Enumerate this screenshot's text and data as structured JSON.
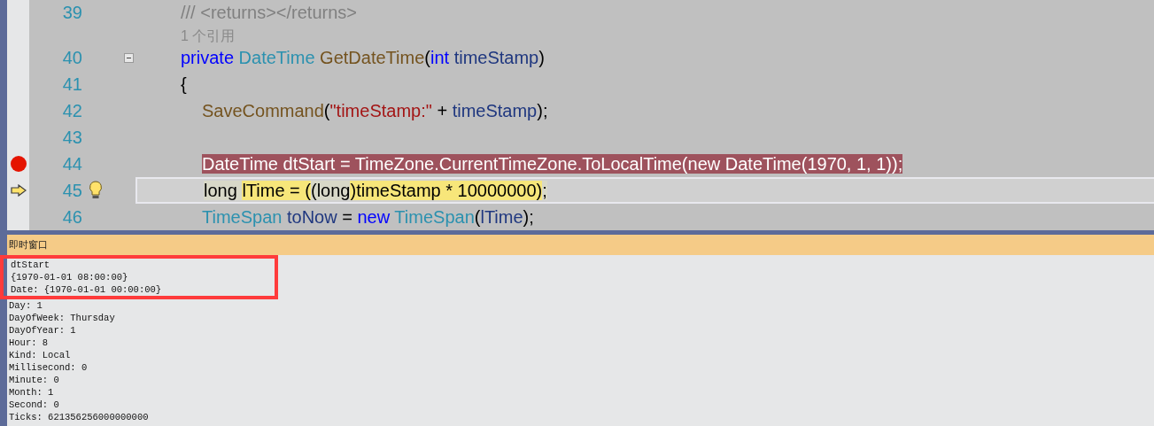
{
  "editor": {
    "lines": [
      {
        "kind": "code",
        "number": "39",
        "statement": false,
        "breakpoint": false,
        "current": false,
        "lightbulb": false,
        "tokens": [
          {
            "text": "/// <returns></returns>",
            "color": "#808080",
            "hl": false
          }
        ]
      },
      {
        "kind": "codelens",
        "text": "1 个引用"
      },
      {
        "kind": "code",
        "number": "40",
        "statement": false,
        "breakpoint": false,
        "current": false,
        "lightbulb": false,
        "expanded": true,
        "tokens": [
          {
            "text": "private ",
            "color": "#0000ff",
            "hl": false
          },
          {
            "text": "DateTime ",
            "color": "#2b91af",
            "hl": false
          },
          {
            "text": "GetDateTime",
            "color": "#74531f",
            "hl": false
          },
          {
            "text": "(",
            "color": "#000000",
            "hl": false
          },
          {
            "text": "int ",
            "color": "#0000ff",
            "hl": false
          },
          {
            "text": "timeStamp",
            "color": "#1f377f",
            "hl": false
          },
          {
            "text": ")",
            "color": "#000000",
            "hl": false
          }
        ]
      },
      {
        "kind": "code",
        "number": "41",
        "statement": false,
        "breakpoint": false,
        "current": false,
        "lightbulb": false,
        "tokens": [
          {
            "text": "{",
            "color": "#000000",
            "hl": false
          }
        ]
      },
      {
        "kind": "code",
        "number": "42",
        "statement": true,
        "breakpoint": false,
        "current": false,
        "lightbulb": false,
        "tokens": [
          {
            "text": "SaveCommand",
            "color": "#74531f",
            "hl": false
          },
          {
            "text": "(",
            "color": "#000000",
            "hl": false
          },
          {
            "text": "\"timeStamp:\"",
            "color": "#a31515",
            "hl": false
          },
          {
            "text": " + ",
            "color": "#000000",
            "hl": false
          },
          {
            "text": "timeStamp",
            "color": "#1f377f",
            "hl": false
          },
          {
            "text": ");",
            "color": "#000000",
            "hl": false
          }
        ]
      },
      {
        "kind": "code",
        "number": "43",
        "breakpoint": false,
        "current": false,
        "lightbulb": false
      },
      {
        "kind": "code",
        "number": "44",
        "statement": true,
        "breakpoint": true,
        "current": false,
        "lightbulb": false,
        "tokens": [
          {
            "text": "DateTime dtStart = TimeZone.CurrentTimeZone.ToLocalTime(new DateTime(1970, 1, 1));",
            "hl": false
          }
        ]
      },
      {
        "kind": "code",
        "number": "45",
        "statement": true,
        "breakpoint": false,
        "current": true,
        "lightbulb": true,
        "tokens": [
          {
            "text": "long ",
            "hl": false
          },
          {
            "text": "lTime = (",
            "hl": true
          },
          {
            "text": "(long",
            "hl": false
          },
          {
            "text": ")timeStamp * 10000000)",
            "hl": true
          },
          {
            "text": ";",
            "hl": false
          }
        ]
      },
      {
        "kind": "code",
        "number": "46",
        "statement": true,
        "breakpoint": false,
        "current": false,
        "lightbulb": false,
        "tokens": [
          {
            "text": "TimeSpan ",
            "color": "#2b91af",
            "hl": false
          },
          {
            "text": "toNow",
            "color": "#1f377f",
            "hl": false
          },
          {
            "text": " = ",
            "color": "#000000",
            "hl": false
          },
          {
            "text": "new ",
            "color": "#0000ff",
            "hl": false
          },
          {
            "text": "TimeSpan",
            "color": "#2b91af",
            "hl": false
          },
          {
            "text": "(",
            "color": "#000000",
            "hl": false
          },
          {
            "text": "lTime",
            "color": "#1f377f",
            "hl": false
          },
          {
            "text": ");",
            "color": "#000000",
            "hl": false
          }
        ]
      }
    ]
  },
  "immediate_window": {
    "title": "即时窗口",
    "lines": [
      {
        "text": "dtStart"
      },
      {
        "text": "{1970-01-01 08:00:00}",
        "children": [
          {
            "text": "Date: {1970-01-01 00:00:00}"
          },
          {
            "text": "Day: 1"
          },
          {
            "text": "DayOfWeek: Thursday"
          },
          {
            "text": "DayOfYear: 1"
          },
          {
            "text": "Hour: 8"
          },
          {
            "text": "Kind: Local"
          },
          {
            "text": "Millisecond: 0"
          },
          {
            "text": "Minute: 0"
          },
          {
            "text": "Month: 1"
          },
          {
            "text": "Second: 0"
          },
          {
            "text": "Ticks: 621356256000000000"
          }
        ]
      }
    ]
  }
}
